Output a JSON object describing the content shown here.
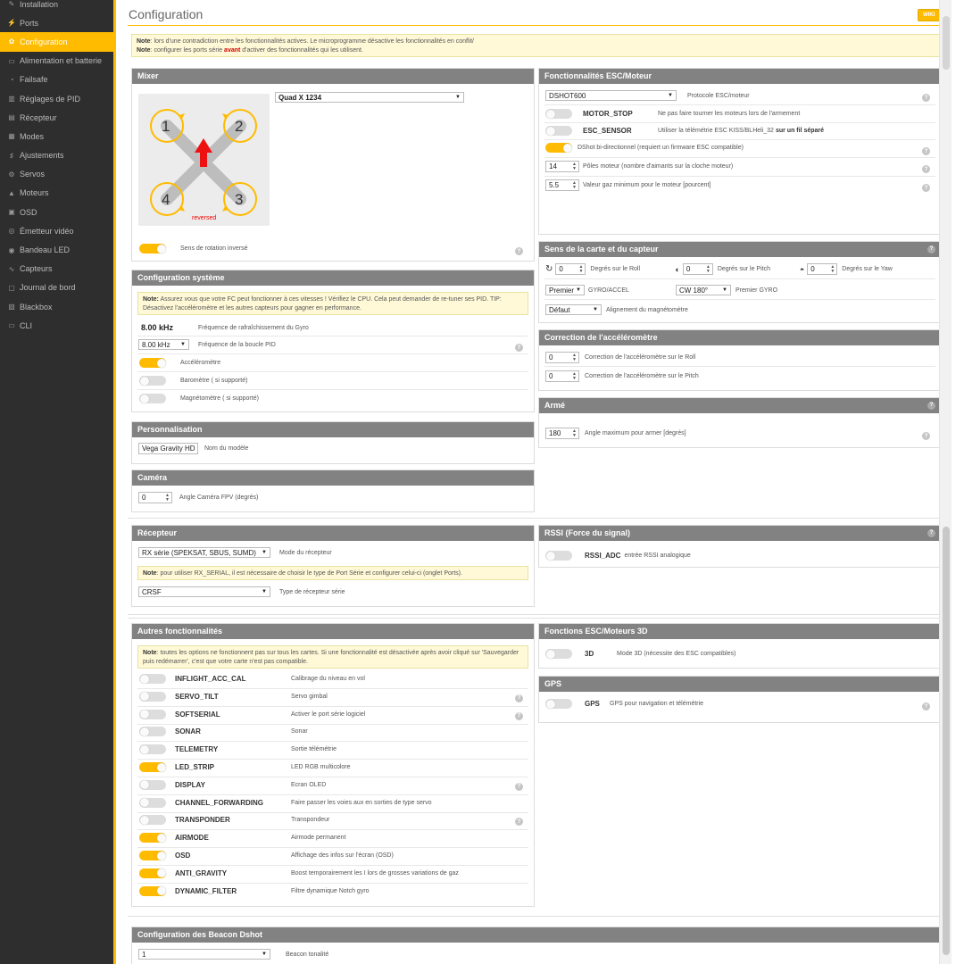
{
  "sidebar": {
    "items": [
      {
        "label": "Installation",
        "icon": "wrench-icon",
        "glyph": "✎"
      },
      {
        "label": "Ports",
        "icon": "plug-icon",
        "glyph": "⚡"
      },
      {
        "label": "Configuration",
        "icon": "gear-icon",
        "glyph": "✿",
        "active": true
      },
      {
        "label": "Alimentation et batterie",
        "icon": "battery-icon",
        "glyph": "▭"
      },
      {
        "label": "Failsafe",
        "icon": "failsafe-icon",
        "glyph": "◔"
      },
      {
        "label": "Réglages de PID",
        "icon": "pid-icon",
        "glyph": "▥"
      },
      {
        "label": "Récepteur",
        "icon": "receiver-icon",
        "glyph": "▤"
      },
      {
        "label": "Modes",
        "icon": "modes-icon",
        "glyph": "▦"
      },
      {
        "label": "Ajustements",
        "icon": "sliders-icon",
        "glyph": "♯"
      },
      {
        "label": "Servos",
        "icon": "servo-icon",
        "glyph": "⚙"
      },
      {
        "label": "Moteurs",
        "icon": "motor-icon",
        "glyph": "▲"
      },
      {
        "label": "OSD",
        "icon": "osd-icon",
        "glyph": "▣"
      },
      {
        "label": "Émetteur vidéo",
        "icon": "vtx-icon",
        "glyph": "◎"
      },
      {
        "label": "Bandeau LED",
        "icon": "led-icon",
        "glyph": "◉"
      },
      {
        "label": "Capteurs",
        "icon": "sensor-icon",
        "glyph": "∿"
      },
      {
        "label": "Journal de bord",
        "icon": "log-icon",
        "glyph": "▢"
      },
      {
        "label": "Blackbox",
        "icon": "blackbox-icon",
        "glyph": "▧"
      },
      {
        "label": "CLI",
        "icon": "cli-icon",
        "glyph": "▭"
      }
    ]
  },
  "header": {
    "title": "Configuration",
    "wiki": "WIKI"
  },
  "top_note": {
    "label1": "Note",
    "text1": ": lors d'une contradiction entre les fonctionnalités actives. Le microprogramme désactive les fonctionnalités en conflit/",
    "label2": "Note",
    "text2a": ": configurer les ports série ",
    "text2b": "avant",
    "text2c": " d'activer des fonctionnalités qui les utilisent."
  },
  "mixer": {
    "title": "Mixer",
    "preset": "Quad X 1234",
    "motors": [
      "1",
      "2",
      "3",
      "4"
    ],
    "reversed_label": "reversed",
    "reverse_label": "Sens de rotation inversé",
    "reverse_on": true
  },
  "esc": {
    "title": "Fonctionnalités ESC/Moteur",
    "protocol": "DSHOT600",
    "protocol_label": "Protocole ESC/moteur",
    "motor_stop": "MOTOR_STOP",
    "motor_stop_desc": "Ne pas faire tourner les moteurs lors de l'armement",
    "esc_sensor": "ESC_SENSOR",
    "esc_sensor_desc": "Utiliser la télémétrie ESC KISS/BLHeli_32",
    "esc_sensor_bold": "sur un fil séparé",
    "bidir_desc": "DShot bi-directionnel (requiert un firmware ESC compatible)",
    "poles": "14",
    "poles_label": "Pôles moteur (nombre d'aimants sur la cloche moteur)",
    "idle": "5.5",
    "idle_label": "Valeur gaz minimum pour le moteur [pourcent]"
  },
  "system": {
    "title": "Configuration système",
    "note_label": "Note:",
    "note_text": " Assurez vous que votre FC peut fonctionner à ces vitesses ! Vérifiez le CPU. Cela peut demander de re-tuner ses PID. TIP: Désactivez l'accéléromètre et les autres capteurs pour gagner en performance.",
    "gyro_freq": "8.00 kHz",
    "gyro_label": "Fréquence de rafraîchissement du Gyro",
    "pid_freq": "8.00 kHz",
    "pid_label": "Fréquence de la boucle PID",
    "acc_label": "Accéléromètre",
    "baro_label": "Baromètre ( si supporté)",
    "mag_label": "Magnétomètre ( si supporté)"
  },
  "board": {
    "title": "Sens de la carte et du capteur",
    "roll": "0",
    "roll_label": "Degrés sur le Roll",
    "pitch": "0",
    "pitch_label": "Degrés sur le Pitch",
    "yaw": "0",
    "yaw_label": "Degrés sur le Yaw",
    "gyro_sel": "Premier",
    "gyro_label": "GYRO/ACCEL",
    "gyro_align": "CW 180°",
    "gyro_align_label": "Premier GYRO",
    "mag_align": "Défaut",
    "mag_align_label": "Alignement du magnétomètre"
  },
  "accel": {
    "title": "Correction de l'accéléromètre",
    "roll": "0",
    "roll_label": "Correction de l'accéléromètre sur le Roll",
    "pitch": "0",
    "pitch_label": "Correction de l'accéléromètre sur le Pitch"
  },
  "arm": {
    "title": "Armé",
    "angle": "180",
    "angle_label": "Angle maximum pour armer [degrés]"
  },
  "personal": {
    "title": "Personnalisation",
    "name": "Vega Gravity HD",
    "name_label": "Nom du modèle"
  },
  "camera": {
    "title": "Caméra",
    "angle": "0",
    "angle_label": "Angle Caméra FPV (degrés)"
  },
  "receiver": {
    "title": "Récepteur",
    "mode": "RX série (SPEKSAT, SBUS, SUMD)",
    "mode_label": "Mode du récepteur",
    "note_label": "Note",
    "note_text": ": pour utiliser RX_SERIAL, il est nécessaire de choisir le type de Port Série et configurer celui-ci (onglet Ports).",
    "type": "CRSF",
    "type_label": "Type de récepteur série"
  },
  "rssi": {
    "title": "RSSI (Force du signal)",
    "name": "RSSI_ADC",
    "desc": "entrée RSSI analogique"
  },
  "other": {
    "title": "Autres fonctionnalités",
    "note_label": "Note",
    "note_text": ": toutes les options ne fonctionnent pas sur tous les cartes. Si une fonctionnalité est désactivée après avoir cliqué sur 'Sauvegarder puis redémarrer', c'est que votre carte n'est pas compatible.",
    "features": [
      {
        "name": "INFLIGHT_ACC_CAL",
        "desc": "Calibrage du niveau en vol",
        "on": false,
        "help": false
      },
      {
        "name": "SERVO_TILT",
        "desc": "Servo gimbal",
        "on": false,
        "help": true
      },
      {
        "name": "SOFTSERIAL",
        "desc": "Activer le port série logiciel",
        "on": false,
        "help": true
      },
      {
        "name": "SONAR",
        "desc": "Sonar",
        "on": false,
        "help": false
      },
      {
        "name": "TELEMETRY",
        "desc": "Sortie télémétrie",
        "on": false,
        "help": false
      },
      {
        "name": "LED_STRIP",
        "desc": "LED RGB multicolore",
        "on": true,
        "help": false
      },
      {
        "name": "DISPLAY",
        "desc": "Ecran OLED",
        "on": false,
        "help": true
      },
      {
        "name": "CHANNEL_FORWARDING",
        "desc": "Faire passer les voies aux en sorties de type servo",
        "on": false,
        "help": false
      },
      {
        "name": "TRANSPONDER",
        "desc": "Transpondeur",
        "on": false,
        "help": true
      },
      {
        "name": "AIRMODE",
        "desc": "Airmode permanent",
        "on": true,
        "help": false
      },
      {
        "name": "OSD",
        "desc": "Affichage des infos sur l'écran (OSD)",
        "on": true,
        "help": false
      },
      {
        "name": "ANTI_GRAVITY",
        "desc": "Boost temporairement les I lors de grosses variations de gaz",
        "on": true,
        "help": false
      },
      {
        "name": "DYNAMIC_FILTER",
        "desc": "Filtre dynamique Notch gyro",
        "on": true,
        "help": false
      }
    ]
  },
  "esc3d": {
    "title": "Fonctions ESC/Moteurs 3D",
    "name": "3D",
    "desc": "Mode 3D (nécessite des ESC compatibles)"
  },
  "gps": {
    "title": "GPS",
    "name": "GPS",
    "desc": "GPS pour navigation et télémétrie"
  },
  "beacon": {
    "title": "Configuration des Beacon Dshot",
    "tone": "1",
    "tone_label": "Beacon tonalité"
  },
  "help_glyph": "?",
  "colors": {
    "accent": "#ffbb00",
    "header_gray": "#828282",
    "sidebar": "#2e2e2e"
  }
}
